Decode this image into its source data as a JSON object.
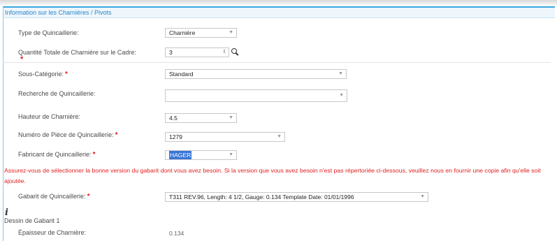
{
  "panel": {
    "title": "Information sur les Charnières / Pivots"
  },
  "fields": {
    "type_quincaillerie": {
      "label": "Type de Quincaillerie:",
      "value": "Charnière"
    },
    "quantite_totale": {
      "label": "Quantité Totale de Charnière sur le Cadre:",
      "value": "3"
    },
    "sous_categorie": {
      "label": "Sous-Catégorie:",
      "value": "Standard"
    },
    "recherche": {
      "label": "Recherche de Quincaillerie:",
      "value": ""
    },
    "hauteur": {
      "label": "Hauteur de Charnière:",
      "value": "4.5"
    },
    "numero_piece": {
      "label": "Numéro de Pièce de Quincaillerie:",
      "value": "1279"
    },
    "fabricant": {
      "label": "Fabricant de Quincaillerie:",
      "value": "HAGER"
    },
    "gabarit": {
      "label": "Gabarit de Quincaillerie:",
      "value": "T311 REV.96, Length: 4 1/2, Gauge: 0.134 Template Date: 01/01/1996"
    },
    "epaisseur": {
      "label": "Épaisseur de Charnière:",
      "value": "0.134"
    }
  },
  "required_marker": "*",
  "warning_text": "Assurez-vous de sélectionner la bonne version du gabarit dont vous avez besoin. Si la version que vous avez besoin n'est pas répertoriée ci-dessous, veuillez nous en fournir une copie afin qu'elle soit ajoutée.",
  "info": {
    "icon_glyph": "i",
    "dessin_label": "Dessin de Gabarit 1"
  },
  "icons": {
    "dropdown": "▼",
    "stepper": "⇕",
    "search": "magnifier-icon",
    "info": "info-icon"
  },
  "colors": {
    "accent": "#2c86c7",
    "required": "#e02020",
    "selection": "#3875d7"
  }
}
